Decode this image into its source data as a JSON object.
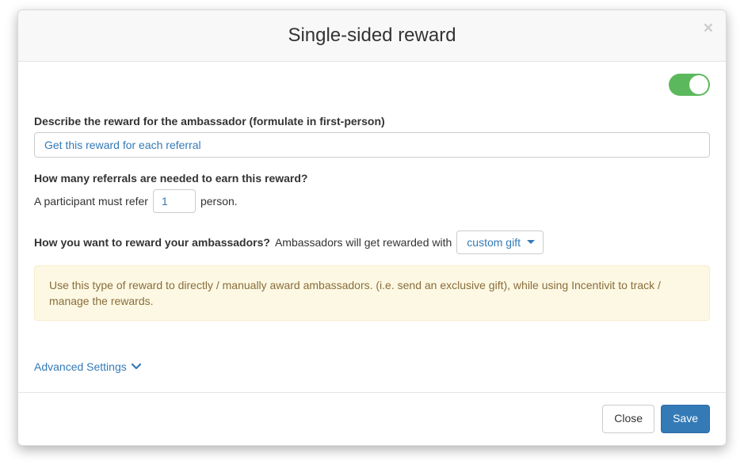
{
  "modal": {
    "title": "Single-sided reward",
    "close_symbol": "×"
  },
  "toggle": {
    "enabled": true
  },
  "reward_description": {
    "label": "Describe the reward for the ambassador (formulate in first-person)",
    "value": "Get this reward for each referral"
  },
  "referrals_needed": {
    "label": "How many referrals are needed to earn this reward?",
    "sentence_before": "A participant must refer",
    "value": "1",
    "sentence_after": "person."
  },
  "reward_type": {
    "label_bold": "How you want to reward your ambassadors?",
    "label_plain": "Ambassadors will get rewarded with",
    "selected": "custom gift"
  },
  "info": {
    "text": "Use this type of reward to directly / manually award ambassadors. (i.e. send an exclusive gift), while using Incentivit to track / manage the rewards."
  },
  "advanced": {
    "label": "Advanced Settings"
  },
  "footer": {
    "close_label": "Close",
    "save_label": "Save"
  }
}
